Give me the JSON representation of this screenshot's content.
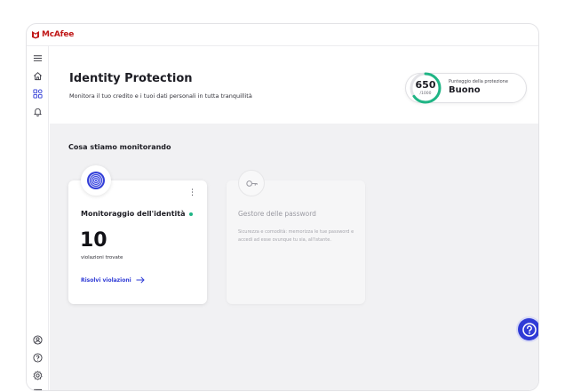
{
  "app": {
    "brand": "McAfee"
  },
  "header": {
    "title": "Identity Protection",
    "subtitle": "Monitora il tuo credito e i tuoi dati personali in tutta tranquillità"
  },
  "score": {
    "value": "650",
    "max": "/1000",
    "fraction": 0.65,
    "label": "Punteggio della protezione",
    "rating": "Buono",
    "accent_color": "#1fb585"
  },
  "section": {
    "title": "Cosa stiamo monitorando"
  },
  "cards": [
    {
      "title": "Monitoraggio dell'identità",
      "status_color": "#1fb585",
      "count": "10",
      "count_label": "violazioni trovate",
      "action_label": "Risolvi violazioni",
      "menu_icon": "kebab-icon",
      "icon": "fingerprint-icon"
    },
    {
      "title": "Gestore delle password",
      "description": "Sicurezza e comodità: memorizza le tue password e accedi ad esse ovunque tu sia, all'istante.",
      "icon": "key-icon"
    }
  ],
  "sidebar": {
    "top_icons": [
      "menu-icon",
      "home-icon",
      "apps-icon",
      "bell-icon"
    ],
    "bottom_icons": [
      "account-icon",
      "help-icon",
      "settings-icon",
      "feedback-icon"
    ],
    "active": "apps-icon"
  },
  "colors": {
    "accent": "#2f3bd6",
    "brand": "#c01818"
  }
}
